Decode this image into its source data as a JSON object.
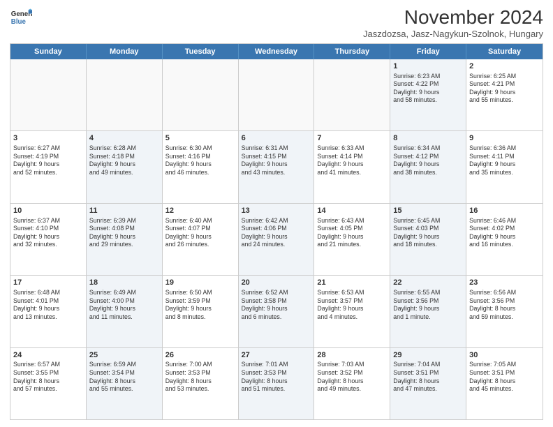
{
  "logo": {
    "line1": "General",
    "line2": "Blue"
  },
  "title": "November 2024",
  "subtitle": "Jaszdozsa, Jasz-Nagykun-Szolnok, Hungary",
  "headers": [
    "Sunday",
    "Monday",
    "Tuesday",
    "Wednesday",
    "Thursday",
    "Friday",
    "Saturday"
  ],
  "rows": [
    [
      {
        "day": "",
        "info": "",
        "shaded": false,
        "empty": true
      },
      {
        "day": "",
        "info": "",
        "shaded": false,
        "empty": true
      },
      {
        "day": "",
        "info": "",
        "shaded": false,
        "empty": true
      },
      {
        "day": "",
        "info": "",
        "shaded": false,
        "empty": true
      },
      {
        "day": "",
        "info": "",
        "shaded": false,
        "empty": true
      },
      {
        "day": "1",
        "info": "Sunrise: 6:23 AM\nSunset: 4:22 PM\nDaylight: 9 hours\nand 58 minutes.",
        "shaded": true,
        "empty": false
      },
      {
        "day": "2",
        "info": "Sunrise: 6:25 AM\nSunset: 4:21 PM\nDaylight: 9 hours\nand 55 minutes.",
        "shaded": false,
        "empty": false
      }
    ],
    [
      {
        "day": "3",
        "info": "Sunrise: 6:27 AM\nSunset: 4:19 PM\nDaylight: 9 hours\nand 52 minutes.",
        "shaded": false,
        "empty": false
      },
      {
        "day": "4",
        "info": "Sunrise: 6:28 AM\nSunset: 4:18 PM\nDaylight: 9 hours\nand 49 minutes.",
        "shaded": true,
        "empty": false
      },
      {
        "day": "5",
        "info": "Sunrise: 6:30 AM\nSunset: 4:16 PM\nDaylight: 9 hours\nand 46 minutes.",
        "shaded": false,
        "empty": false
      },
      {
        "day": "6",
        "info": "Sunrise: 6:31 AM\nSunset: 4:15 PM\nDaylight: 9 hours\nand 43 minutes.",
        "shaded": true,
        "empty": false
      },
      {
        "day": "7",
        "info": "Sunrise: 6:33 AM\nSunset: 4:14 PM\nDaylight: 9 hours\nand 41 minutes.",
        "shaded": false,
        "empty": false
      },
      {
        "day": "8",
        "info": "Sunrise: 6:34 AM\nSunset: 4:12 PM\nDaylight: 9 hours\nand 38 minutes.",
        "shaded": true,
        "empty": false
      },
      {
        "day": "9",
        "info": "Sunrise: 6:36 AM\nSunset: 4:11 PM\nDaylight: 9 hours\nand 35 minutes.",
        "shaded": false,
        "empty": false
      }
    ],
    [
      {
        "day": "10",
        "info": "Sunrise: 6:37 AM\nSunset: 4:10 PM\nDaylight: 9 hours\nand 32 minutes.",
        "shaded": false,
        "empty": false
      },
      {
        "day": "11",
        "info": "Sunrise: 6:39 AM\nSunset: 4:08 PM\nDaylight: 9 hours\nand 29 minutes.",
        "shaded": true,
        "empty": false
      },
      {
        "day": "12",
        "info": "Sunrise: 6:40 AM\nSunset: 4:07 PM\nDaylight: 9 hours\nand 26 minutes.",
        "shaded": false,
        "empty": false
      },
      {
        "day": "13",
        "info": "Sunrise: 6:42 AM\nSunset: 4:06 PM\nDaylight: 9 hours\nand 24 minutes.",
        "shaded": true,
        "empty": false
      },
      {
        "day": "14",
        "info": "Sunrise: 6:43 AM\nSunset: 4:05 PM\nDaylight: 9 hours\nand 21 minutes.",
        "shaded": false,
        "empty": false
      },
      {
        "day": "15",
        "info": "Sunrise: 6:45 AM\nSunset: 4:03 PM\nDaylight: 9 hours\nand 18 minutes.",
        "shaded": true,
        "empty": false
      },
      {
        "day": "16",
        "info": "Sunrise: 6:46 AM\nSunset: 4:02 PM\nDaylight: 9 hours\nand 16 minutes.",
        "shaded": false,
        "empty": false
      }
    ],
    [
      {
        "day": "17",
        "info": "Sunrise: 6:48 AM\nSunset: 4:01 PM\nDaylight: 9 hours\nand 13 minutes.",
        "shaded": false,
        "empty": false
      },
      {
        "day": "18",
        "info": "Sunrise: 6:49 AM\nSunset: 4:00 PM\nDaylight: 9 hours\nand 11 minutes.",
        "shaded": true,
        "empty": false
      },
      {
        "day": "19",
        "info": "Sunrise: 6:50 AM\nSunset: 3:59 PM\nDaylight: 9 hours\nand 8 minutes.",
        "shaded": false,
        "empty": false
      },
      {
        "day": "20",
        "info": "Sunrise: 6:52 AM\nSunset: 3:58 PM\nDaylight: 9 hours\nand 6 minutes.",
        "shaded": true,
        "empty": false
      },
      {
        "day": "21",
        "info": "Sunrise: 6:53 AM\nSunset: 3:57 PM\nDaylight: 9 hours\nand 4 minutes.",
        "shaded": false,
        "empty": false
      },
      {
        "day": "22",
        "info": "Sunrise: 6:55 AM\nSunset: 3:56 PM\nDaylight: 9 hours\nand 1 minute.",
        "shaded": true,
        "empty": false
      },
      {
        "day": "23",
        "info": "Sunrise: 6:56 AM\nSunset: 3:56 PM\nDaylight: 8 hours\nand 59 minutes.",
        "shaded": false,
        "empty": false
      }
    ],
    [
      {
        "day": "24",
        "info": "Sunrise: 6:57 AM\nSunset: 3:55 PM\nDaylight: 8 hours\nand 57 minutes.",
        "shaded": false,
        "empty": false
      },
      {
        "day": "25",
        "info": "Sunrise: 6:59 AM\nSunset: 3:54 PM\nDaylight: 8 hours\nand 55 minutes.",
        "shaded": true,
        "empty": false
      },
      {
        "day": "26",
        "info": "Sunrise: 7:00 AM\nSunset: 3:53 PM\nDaylight: 8 hours\nand 53 minutes.",
        "shaded": false,
        "empty": false
      },
      {
        "day": "27",
        "info": "Sunrise: 7:01 AM\nSunset: 3:53 PM\nDaylight: 8 hours\nand 51 minutes.",
        "shaded": true,
        "empty": false
      },
      {
        "day": "28",
        "info": "Sunrise: 7:03 AM\nSunset: 3:52 PM\nDaylight: 8 hours\nand 49 minutes.",
        "shaded": false,
        "empty": false
      },
      {
        "day": "29",
        "info": "Sunrise: 7:04 AM\nSunset: 3:51 PM\nDaylight: 8 hours\nand 47 minutes.",
        "shaded": true,
        "empty": false
      },
      {
        "day": "30",
        "info": "Sunrise: 7:05 AM\nSunset: 3:51 PM\nDaylight: 8 hours\nand 45 minutes.",
        "shaded": false,
        "empty": false
      }
    ]
  ]
}
